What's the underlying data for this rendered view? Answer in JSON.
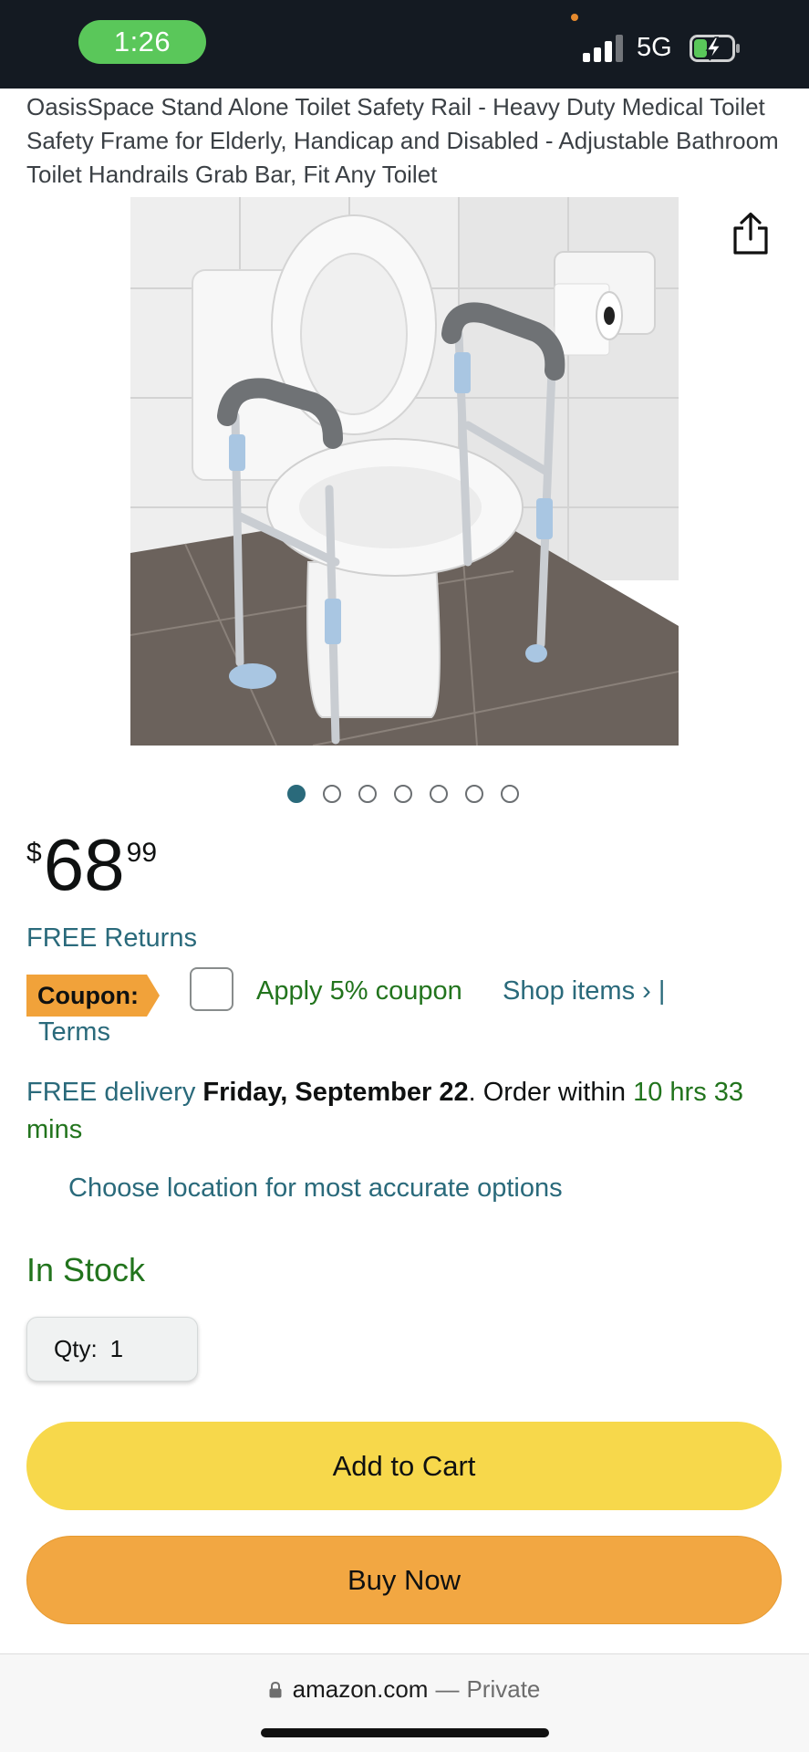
{
  "status_bar": {
    "time": "1:26",
    "network": "5G"
  },
  "product": {
    "title": "OasisSpace Stand Alone Toilet Safety Rail - Heavy Duty Medical Toilet Safety Frame for Elderly, Handicap and Disabled - Adjustable Bathroom Toilet Handrails Grab Bar, Fit Any Toilet",
    "carousel": {
      "total": 7,
      "active_index": 0
    }
  },
  "price": {
    "symbol": "$",
    "whole": "68",
    "fraction": "99"
  },
  "returns": "FREE Returns",
  "coupon": {
    "badge": "Coupon:",
    "apply_text": "Apply 5% coupon",
    "shop_items": "Shop items ›",
    "separator": "|",
    "terms": "Terms"
  },
  "delivery": {
    "prefix": "FREE delivery",
    "date": "Friday, September 22",
    "middle": ". Order within ",
    "countdown": "10 hrs 33 mins"
  },
  "location_link": "Choose location for most accurate options",
  "stock_status": "In Stock",
  "quantity": {
    "label": "Qty:",
    "value": "1"
  },
  "buttons": {
    "add_to_cart": "Add to Cart",
    "buy_now": "Buy Now"
  },
  "browser": {
    "domain": "amazon.com",
    "separator": "—",
    "privacy": "Private"
  },
  "colors": {
    "status_bar_bg": "#141a22",
    "time_pill": "#5ac75a",
    "link_teal": "#2a6a7b",
    "success_green": "#22741d",
    "add_to_cart_yellow": "#f7d84b",
    "buy_now_orange": "#f2a742",
    "coupon_badge": "#f1a23a"
  }
}
